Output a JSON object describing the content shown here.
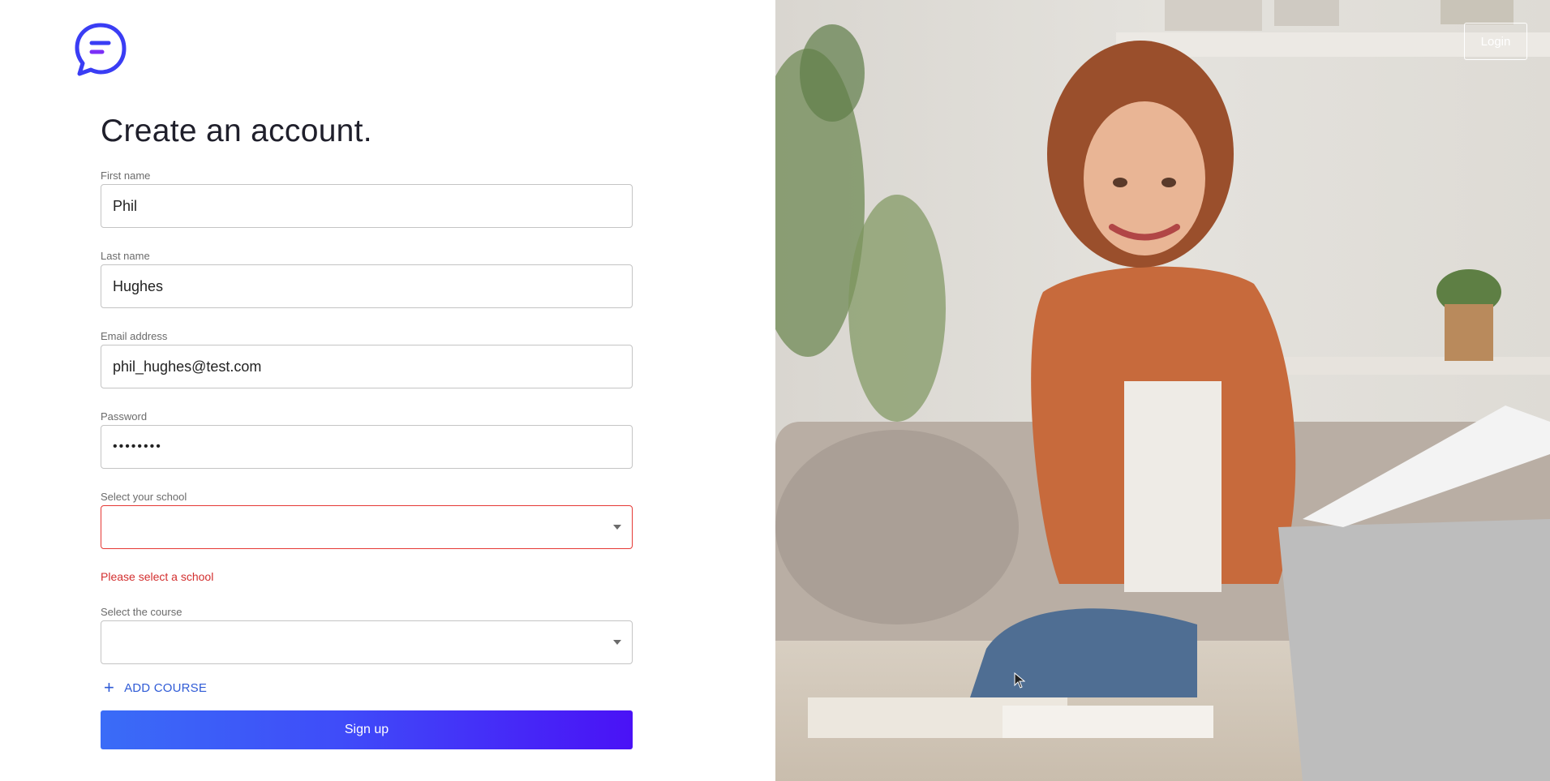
{
  "logo": {
    "icon": "chat-bubble-logo-icon",
    "color": "#3a3df4"
  },
  "heading": "Create an account.",
  "form": {
    "first_name": {
      "label": "First name",
      "value": "Phil"
    },
    "last_name": {
      "label": "Last name",
      "value": "Hughes"
    },
    "email": {
      "label": "Email address",
      "value": "phil_hughes@test.com"
    },
    "password": {
      "label": "Password",
      "value": "••••••••"
    },
    "school": {
      "label": "Select your school",
      "value": "",
      "error": "Please select a school",
      "error_color": "#d32f2f"
    },
    "course": {
      "label": "Select the course",
      "value": ""
    },
    "add_course_label": "ADD COURSE",
    "signup_label": "Sign up"
  },
  "header": {
    "login_label": "Login"
  },
  "colors": {
    "accent": "#3f4cf9",
    "accent_end": "#4a12f6",
    "link": "#2f5bd6",
    "error": "#e53935"
  }
}
